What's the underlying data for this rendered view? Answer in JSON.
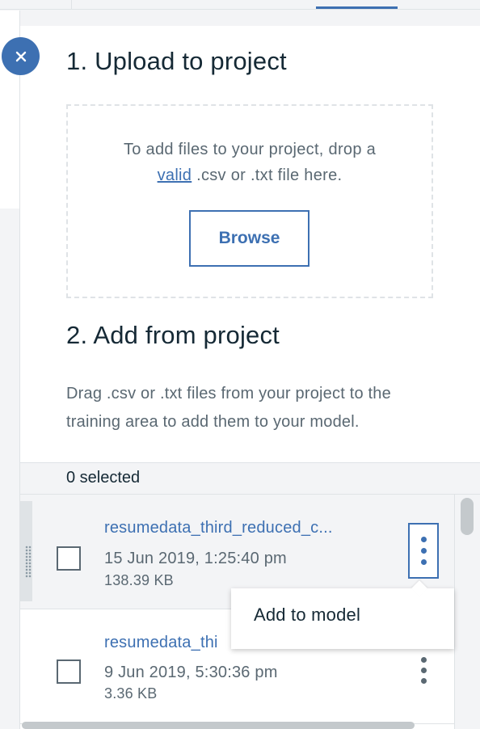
{
  "upload": {
    "heading": "1. Upload to project",
    "drop_text_before": "To add files to your project, drop a",
    "drop_link": "valid",
    "drop_text_after": ".csv or .txt file here.",
    "browse_label": "Browse"
  },
  "add_from_project": {
    "heading": "2. Add from project",
    "description": "Drag .csv or .txt files from your project to the training area to add them to your model."
  },
  "selection": {
    "count_label": "0 selected"
  },
  "files": [
    {
      "name": "resumedata_third_reduced_c...",
      "date": "15 Jun 2019, 1:25:40 pm",
      "size": "138.39 KB"
    },
    {
      "name": "resumedata_thi",
      "date": "9 Jun 2019, 5:30:36 pm",
      "size": "3.36 KB"
    }
  ],
  "context_menu": {
    "item": "Add to model"
  },
  "colors": {
    "accent": "#3d70b2",
    "text": "#152935",
    "muted": "#5a6872",
    "border": "#dfe3e6"
  },
  "icons": {
    "close": "close-icon",
    "overflow": "overflow-menu-icon",
    "drag": "drag-handle-icon"
  }
}
